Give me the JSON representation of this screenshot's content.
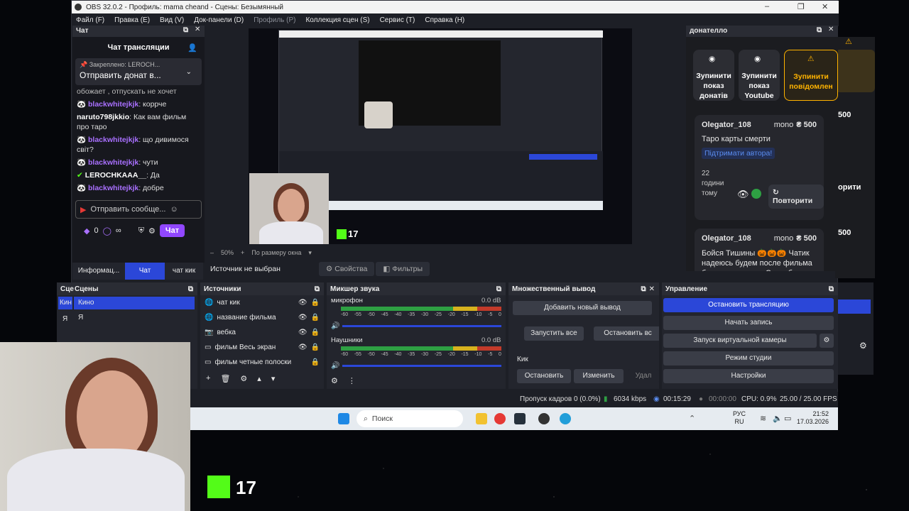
{
  "window": {
    "title": "OBS 32.0.2 - Профиль: mama cheand - Сцены: Безымянный"
  },
  "menu": {
    "file": "Файл (F)",
    "edit": "Правка (E)",
    "view": "Вид (V)",
    "docks": "Док-панели (D)",
    "profile": "Профиль (P)",
    "scenes_collection": "Коллекция сцен (S)",
    "tools": "Сервис (T)",
    "help": "Справка (H)"
  },
  "chat_dock": {
    "title": "Чат",
    "header": "Чат трансляции",
    "pinned_label": "Закреплено:",
    "pinned_user": "LEROCH...",
    "pinned_text": "Отправить донат в...",
    "snippet": "обожает , отпускать не хочет",
    "messages": [
      {
        "user": "blackwhitejkjk",
        "text": ": коррче"
      },
      {
        "user": "naruto798jkkio",
        "text": ": Как вам фильм про таро"
      },
      {
        "user": "blackwhitejkjk",
        "text": ": що дивимося світ?"
      },
      {
        "user": "blackwhitejkjk",
        "text": ": чути"
      },
      {
        "user": "LEROCHKAAA__",
        "text": ": Да"
      },
      {
        "user": "blackwhitejkjk",
        "text": ": добре"
      }
    ],
    "input_placeholder": "Отправить сообще...",
    "count": "0",
    "infinity": "∞",
    "chat_button": "Чат",
    "tabs": [
      "Информац...",
      "Чат",
      "чат кик"
    ]
  },
  "preview": {
    "zoom": "50%",
    "fit_label": "По размеру окна",
    "kick_count": "17",
    "source_status": "Источник не выбран",
    "properties": "Свойства",
    "filters": "Фильтры"
  },
  "donatello": {
    "title": "донателло",
    "btn_stop_donates": "Зупинити показ донатів",
    "btn_stop_youtube": "Зупинити показ Youtube",
    "btn_stop_messages": "Зупинити повідомлен",
    "card1": {
      "user": "Olegator_108",
      "method": "mono",
      "amount": "₴ 500",
      "text": "Таро карты смерти",
      "support": "Підтримати автора!",
      "time": "22 години тому",
      "repeat": "Повторити"
    },
    "card2": {
      "user": "Olegator_108",
      "method": "mono",
      "amount": "₴ 500",
      "text": "Бойся Тишины 🎃🎃🎃 Чатик надеюсь будем после фильма бояться тишины. Спасибо"
    },
    "bg_amount1": "500",
    "bg_repeat": "орити",
    "bg_amount2": "500",
    "bg_amount3": "500"
  },
  "scenes": {
    "title": "Сцены",
    "items": [
      "Кино",
      "Я"
    ],
    "cropped_title": "Сце",
    "cropped_items": [
      "Кин",
      "Я"
    ]
  },
  "sources": {
    "title": "Источники",
    "items": [
      "чат кик",
      "название фильма",
      "вебка",
      "фильм Весь экран",
      "фильм четные полоски"
    ]
  },
  "mixer": {
    "title": "Микшер звука",
    "channels": [
      {
        "name": "микрофон",
        "db": "0.0 dB"
      },
      {
        "name": "Наушники",
        "db": "0.0 dB"
      }
    ],
    "ticks": [
      "-60",
      "-55",
      "-50",
      "-45",
      "-40",
      "-35",
      "-30",
      "-25",
      "-20",
      "-15",
      "-10",
      "-5",
      "0"
    ]
  },
  "multi_output": {
    "title": "Множественный вывод",
    "add": "Добавить новый вывод",
    "start_all": "Запустить все",
    "stop_all": "Остановить вс",
    "target": "Кик",
    "stop": "Остановить",
    "edit": "Изменить",
    "delete": "Удал"
  },
  "controls": {
    "title": "Управление",
    "stop_stream": "Остановить трансляцию",
    "start_record": "Начать запись",
    "virtual_cam": "Запуск виртуальной камеры",
    "studio": "Режим студии",
    "settings": "Настройки"
  },
  "status": {
    "dropped": "Пропуск кадров 0 (0.0%)",
    "bitrate": "6034 kbps",
    "stream_time": "00:15:29",
    "rec_time": "00:00:00",
    "cpu": "CPU: 0.9%",
    "fps": "25.00 / 25.00 FPS"
  },
  "taskbar": {
    "search": "Поиск",
    "lang1": "РУС",
    "lang2": "RU",
    "time": "21:52",
    "date": "17.03.2026"
  },
  "overlay": {
    "kick_count": "17"
  },
  "colors": {
    "accent": "#2b47d8",
    "kick_green": "#53fc18",
    "twitch_purple": "#a970ff"
  }
}
